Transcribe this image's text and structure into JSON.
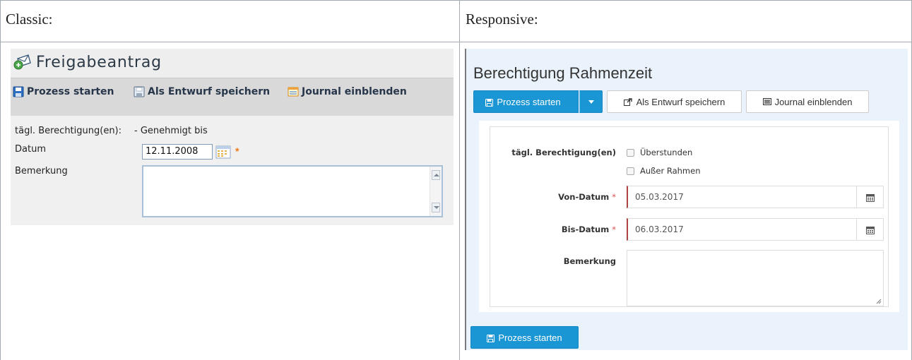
{
  "columns": {
    "classic_header": "Classic:",
    "responsive_header": "Responsive:"
  },
  "classic": {
    "title": "Freigabeantrag",
    "toolbar": {
      "start": "Prozess starten",
      "draft": "Als Entwurf speichern",
      "journal": "Journal einblenden"
    },
    "permissions_label": "tägl. Berechtigung(en):",
    "permissions_value": "- Genehmigt bis",
    "date_label": "Datum",
    "date_value": "12.11.2008",
    "required_marker": "*",
    "remark_label": "Bemerkung",
    "remark_value": ""
  },
  "responsive": {
    "title": "Berechtigung Rahmenzeit",
    "buttons": {
      "start": "Prozess starten",
      "draft": "Als Entwurf speichern",
      "journal": "Journal einblenden",
      "bottom_start": "Prozess starten"
    },
    "form": {
      "permissions_label": "tägl. Berechtigung(en)",
      "options": [
        {
          "label": "Überstunden",
          "checked": false
        },
        {
          "label": "Außer Rahmen",
          "checked": false
        }
      ],
      "from_label": "Von-Datum",
      "from_value": "05.03.2017",
      "to_label": "Bis-Datum",
      "to_value": "06.03.2017",
      "required_marker": "*",
      "remark_label": "Bemerkung",
      "remark_value": ""
    },
    "colors": {
      "primary": "#1a96d4",
      "panel_bg": "#eaf3fb",
      "error_border": "#a94442"
    }
  }
}
